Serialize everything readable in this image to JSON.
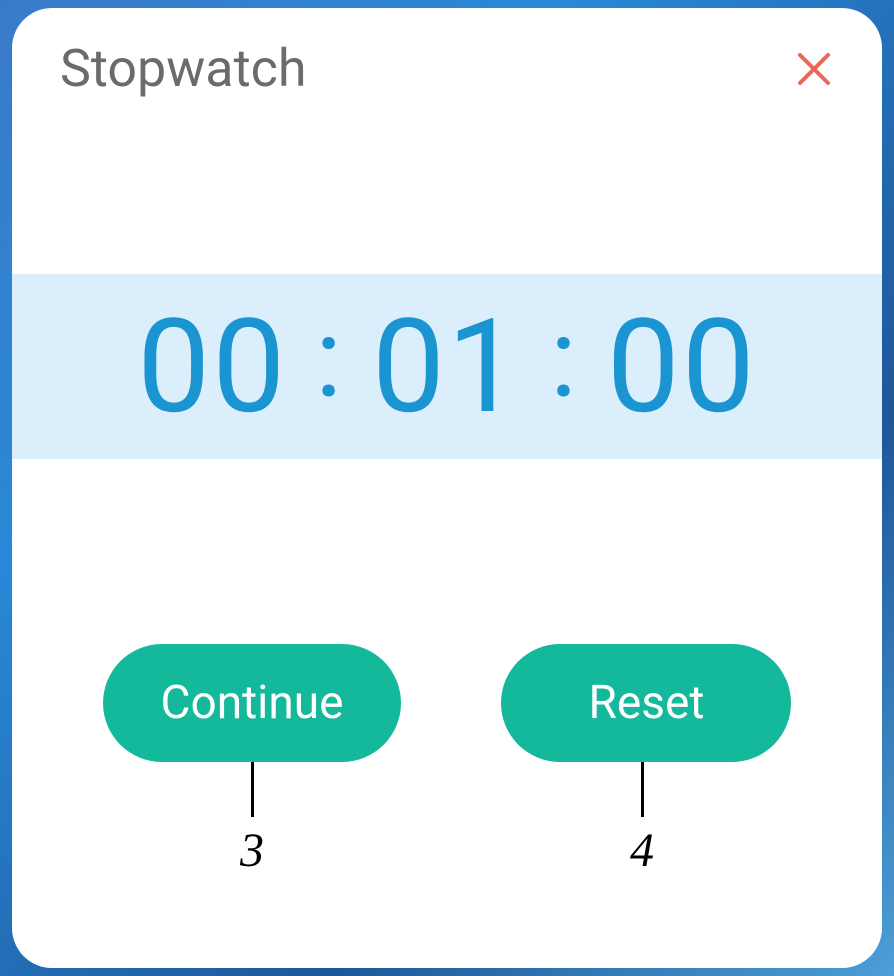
{
  "header": {
    "title": "Stopwatch"
  },
  "time": {
    "hours": "00",
    "minutes": "01",
    "seconds": "00",
    "sep": ":"
  },
  "buttons": {
    "continue_label": "Continue",
    "reset_label": "Reset"
  },
  "annotations": {
    "left": "3",
    "right": "4"
  }
}
